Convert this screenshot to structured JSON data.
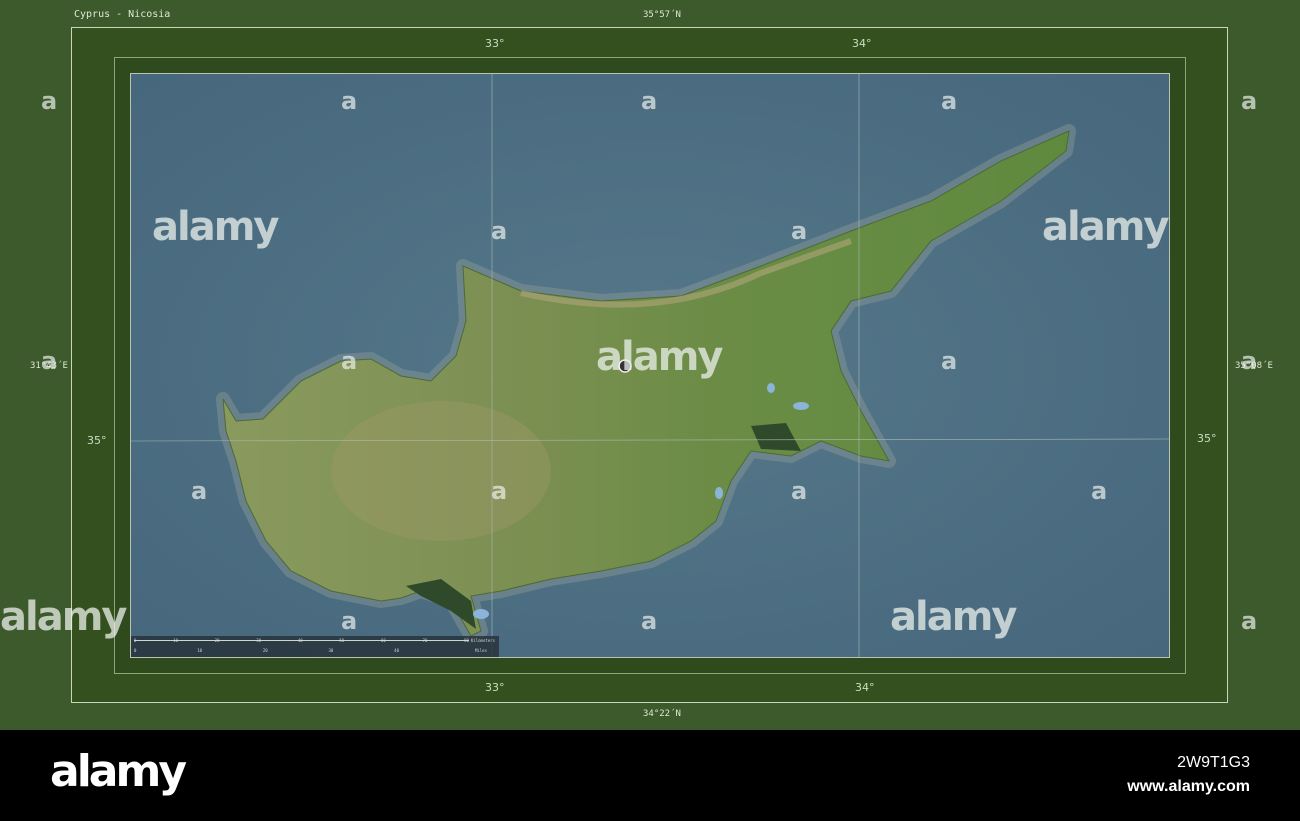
{
  "title": "Cyprus - Nicosia",
  "bounds": {
    "north": "35°57´N",
    "south": "34°22´N",
    "west": "31°43´E",
    "east": "35°08´E"
  },
  "grid_labels": {
    "lon": [
      "33°",
      "34°"
    ],
    "lat": [
      "35°"
    ]
  },
  "scale_bar": {
    "km_ticks": [
      "0",
      "10",
      "20",
      "30",
      "40",
      "50",
      "60",
      "70",
      "80"
    ],
    "km_unit": "Kilometers",
    "mi_ticks": [
      "0",
      "10",
      "20",
      "30",
      "40"
    ],
    "mi_unit": "Miles"
  },
  "capital": "Nicosia",
  "colors": {
    "sea": "#4a6b80",
    "land": "#6f8f4a",
    "frame": "#3d5a2c"
  },
  "watermark": {
    "brand": "alamy",
    "letter": "a",
    "image_id": "2W9T1G3",
    "url": "www.alamy.com"
  }
}
